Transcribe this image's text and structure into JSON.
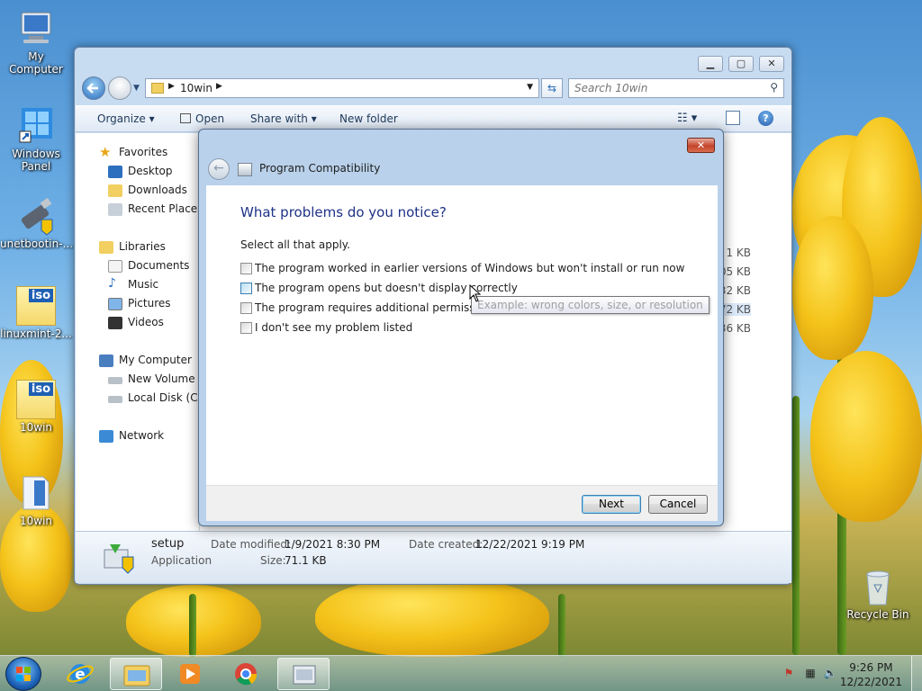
{
  "desktop": {
    "icons": [
      {
        "label": "My Computer"
      },
      {
        "label": "Windows Panel"
      },
      {
        "label": "unetbootin-..."
      },
      {
        "label": "linuxmint-2..."
      },
      {
        "label": "10win",
        "badge": "iso"
      },
      {
        "label": "10win"
      },
      {
        "label": "Recycle Bin"
      }
    ],
    "iso_badge": "iso"
  },
  "explorer": {
    "breadcrumb": "10win",
    "search_placeholder": "Search 10win",
    "toolbar": {
      "organize": "Organize",
      "open": "Open",
      "share_with": "Share with",
      "new_folder": "New folder"
    },
    "nav": {
      "favorites": "Favorites",
      "desktop": "Desktop",
      "downloads": "Downloads",
      "recent_places": "Recent Places",
      "libraries": "Libraries",
      "documents": "Documents",
      "music": "Music",
      "pictures": "Pictures",
      "videos": "Videos",
      "my_computer": "My Computer",
      "new_volume": "New Volume (A",
      "local_disk": "Local Disk (C:)",
      "network": "Network"
    },
    "file_sizes": [
      "1 KB",
      "05 KB",
      "32 KB",
      "72 KB",
      "36 KB"
    ],
    "details": {
      "name": "setup",
      "type": "Application",
      "date_modified_label": "Date modified:",
      "date_modified": "1/9/2021 8:30 PM",
      "date_created_label": "Date created:",
      "date_created": "12/22/2021 9:19 PM",
      "size_label": "Size:",
      "size": "71.1 KB"
    }
  },
  "dialog": {
    "title": "Program Compatibility",
    "heading": "What problems do you notice?",
    "instruction": "Select all that apply.",
    "options": [
      "The program worked in earlier versions of Windows but won't install or run now",
      "The program opens but doesn't display correctly",
      "The program requires additional permissions",
      "I don't see my problem listed"
    ],
    "tooltip": "Example: wrong colors, size, or resolution",
    "next": "Next",
    "cancel": "Cancel"
  },
  "taskbar": {
    "time": "9:26 PM",
    "date": "12/22/2021"
  }
}
